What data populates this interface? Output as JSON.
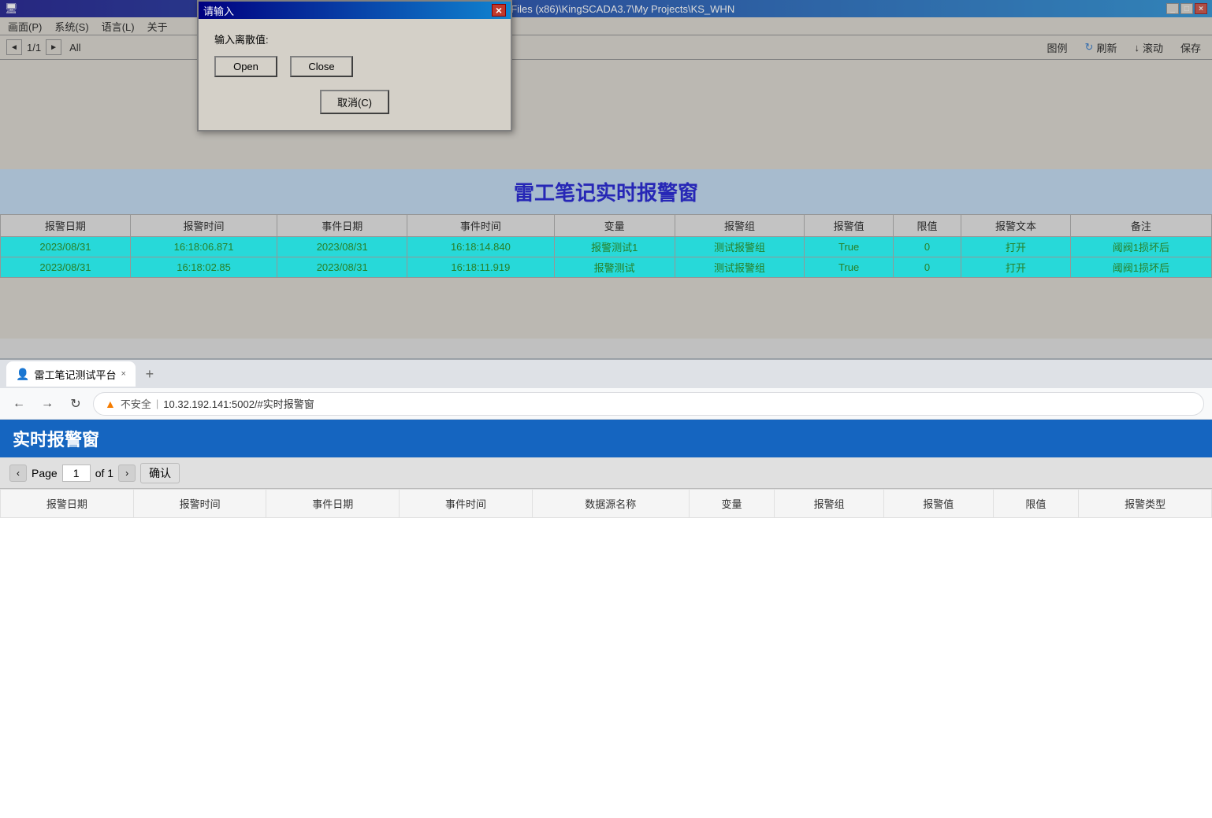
{
  "scada": {
    "title": "请输入",
    "window_title": "- C:\\Program Files (x86)\\KingSCADA3.7\\My Projects\\KS_WHN",
    "menu_items": [
      "画面(P)",
      "系统(S)",
      "语言(L)",
      "关于"
    ],
    "dialog": {
      "title": "请输入",
      "label": "输入离散值:",
      "open_btn": "Open",
      "close_btn": "Close",
      "cancel_btn": "取消(C)"
    },
    "pagination": {
      "prev": "◄",
      "current": "1/1",
      "next": "►",
      "all": "All"
    },
    "toolbar": {
      "legend": "图例",
      "refresh": "刷新",
      "scroll": "滚动",
      "save": "保存"
    },
    "alert_title": "雷工笔记实时报警窗",
    "table": {
      "headers": [
        "报警日期",
        "报警时间",
        "事件日期",
        "事件时间",
        "变量",
        "报警组",
        "报警值",
        "限值",
        "报警文本",
        "备注"
      ],
      "rows": [
        {
          "alarm_date": "2023/08/31",
          "alarm_time": "16:18:06.871",
          "event_date": "2023/08/31",
          "event_time": "16:18:14.840",
          "variable": "报警测试1",
          "alarm_group": "测试报警组",
          "alarm_value": "True",
          "limit": "0",
          "alarm_text": "打开",
          "note": "阈阀1损坏后"
        },
        {
          "alarm_date": "2023/08/31",
          "alarm_time": "16:18:02.85",
          "event_date": "2023/08/31",
          "event_time": "16:18:11.919",
          "variable": "报警测试",
          "alarm_group": "测试报警组",
          "alarm_value": "True",
          "limit": "0",
          "alarm_text": "打开",
          "note": "阈阀1损坏后"
        }
      ]
    }
  },
  "browser": {
    "tab_title": "雷工笔记测试平台",
    "tab_close": "×",
    "tab_add": "+",
    "nav": {
      "back": "←",
      "forward": "→",
      "refresh": "↻",
      "warning": "▲",
      "address": "10.32.192.141:5002/#实时报警窗",
      "not_secure": "不安全",
      "separator": "|"
    },
    "header_title": "实时报警窗",
    "pagination": {
      "prev": "‹",
      "page_label": "Page",
      "current": "1",
      "of_label": "of 1",
      "next": "›",
      "confirm": "确认"
    },
    "table": {
      "headers": [
        "报警日期",
        "报警时间",
        "事件日期",
        "事件时间",
        "数据源名称",
        "变量",
        "报警组",
        "报警值",
        "限值",
        "报警类型"
      ],
      "rows": []
    }
  }
}
